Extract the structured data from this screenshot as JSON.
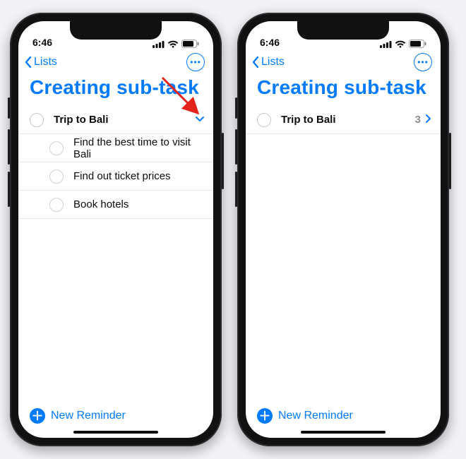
{
  "status": {
    "time": "6:46"
  },
  "nav": {
    "back_label": "Lists"
  },
  "title": "Creating sub-task",
  "bottom": {
    "new_reminder": "New Reminder"
  },
  "left": {
    "parent": {
      "label": "Trip to Bali"
    },
    "subtasks": [
      {
        "label": "Find the best time to visit Bali"
      },
      {
        "label": "Find out ticket prices"
      },
      {
        "label": "Book hotels"
      }
    ]
  },
  "right": {
    "parent": {
      "label": "Trip to Bali",
      "count": "3"
    }
  }
}
